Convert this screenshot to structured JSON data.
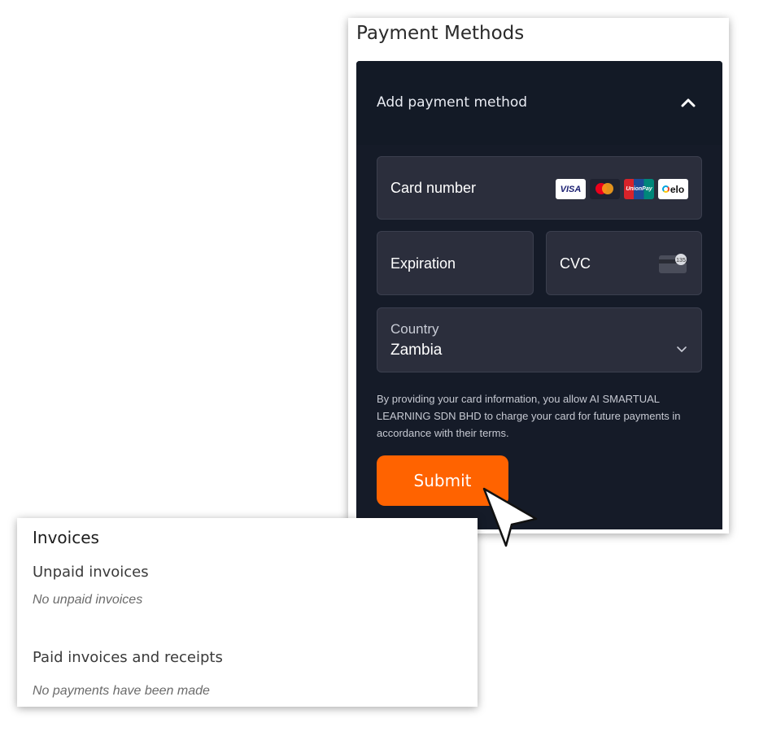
{
  "payment_methods": {
    "title": "Payment Methods",
    "add_label": "Add payment method",
    "card_number_label": "Card number",
    "card_brands": [
      "VISA",
      "Mastercard",
      "UnionPay",
      "elo"
    ],
    "brand_labels": {
      "visa": "VISA",
      "unionpay": "UnionPay",
      "elo": "elo"
    },
    "cvc_sample": "135",
    "expiration_label": "Expiration",
    "cvc_label": "CVC",
    "country_label": "Country",
    "country_value": "Zambia",
    "notice": "By providing your card information, you allow AI SMARTUAL LEARNING SDN BHD to charge your card for future payments in accordance with their terms.",
    "submit_label": "Submit"
  },
  "invoices": {
    "title": "Invoices",
    "unpaid_heading": "Unpaid invoices",
    "unpaid_empty": "No unpaid invoices",
    "paid_heading": "Paid invoices and receipts",
    "paid_empty": "No payments have been made"
  },
  "colors": {
    "accent": "#ff6300",
    "panel_dark": "#151b28",
    "field_bg": "#2b2e3c"
  },
  "icons": [
    "chevron-up-icon",
    "visa-icon",
    "mastercard-icon",
    "unionpay-icon",
    "elo-icon",
    "cvc-card-icon",
    "chevron-down-icon",
    "mouse-cursor-icon"
  ]
}
